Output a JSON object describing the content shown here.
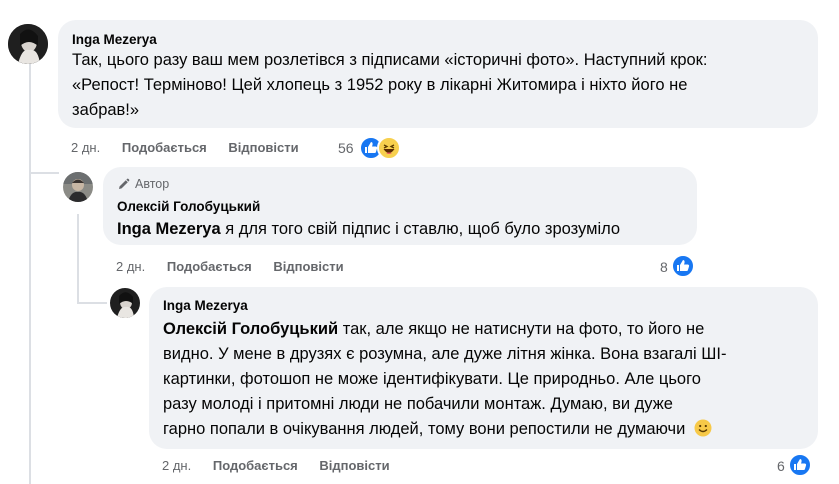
{
  "top_cut_text": "…",
  "comments": [
    {
      "author": "Inga Mezerya",
      "text": "Так, цього разу ваш мем розлетівся з підписами «історичні фото». Наступний крок: «Репост! Терміново! Цей хлопець з 1952 року в лікарні Житомира і ніхто його не забрав!»",
      "lines": [
        "Так, цього разу ваш мем розлетівся з підписами «історичні фото». Наступний крок:",
        "«Репост! Терміново! Цей хлопець з 1952 року в лікарні Житомира і ніхто його не",
        "забрав!»"
      ],
      "time": "2 дн.",
      "like_label": "Подобається",
      "reply_label": "Відповісти",
      "reactions_count": "56",
      "reactions": [
        "like",
        "haha"
      ]
    },
    {
      "author_badge": "Автор",
      "author": "Олексій Голобуцький",
      "mention": "Inga Mezerya",
      "text": " я для того свій підпис і ставлю, щоб було зрозуміло",
      "time": "2 дн.",
      "like_label": "Подобається",
      "reply_label": "Відповісти",
      "reactions_count": "8",
      "reactions": [
        "like"
      ]
    },
    {
      "author": "Inga Mezerya",
      "mention": "Олексій Голобуцький",
      "lines": [
        " так, але якщо не натиснути на фото, то його не",
        "видно. У мене в друзях є розумна, але дуже літня жінка. Вона взагалі ШІ-",
        "картинки, фотошоп не може ідентифікувати. Це природньо. Але цього",
        "разу молоді і притомні люди не побачили монтаж. Думаю, ви дуже",
        "гарно попали в очікування людей, тому вони репостили не думаючи"
      ],
      "emoji": "🙂",
      "time": "2 дн.",
      "like_label": "Подобається",
      "reply_label": "Відповісти",
      "reactions_count": "6",
      "reactions": [
        "like"
      ]
    }
  ],
  "colors": {
    "bubble": "#f0f2f5",
    "meta_text": "#65676b",
    "like_blue": "#1877f2",
    "thread_line": "#dcdfe4"
  },
  "icons": [
    "pencil-icon",
    "like-reaction-icon",
    "haha-reaction-icon",
    "smile-emoji-icon"
  ]
}
